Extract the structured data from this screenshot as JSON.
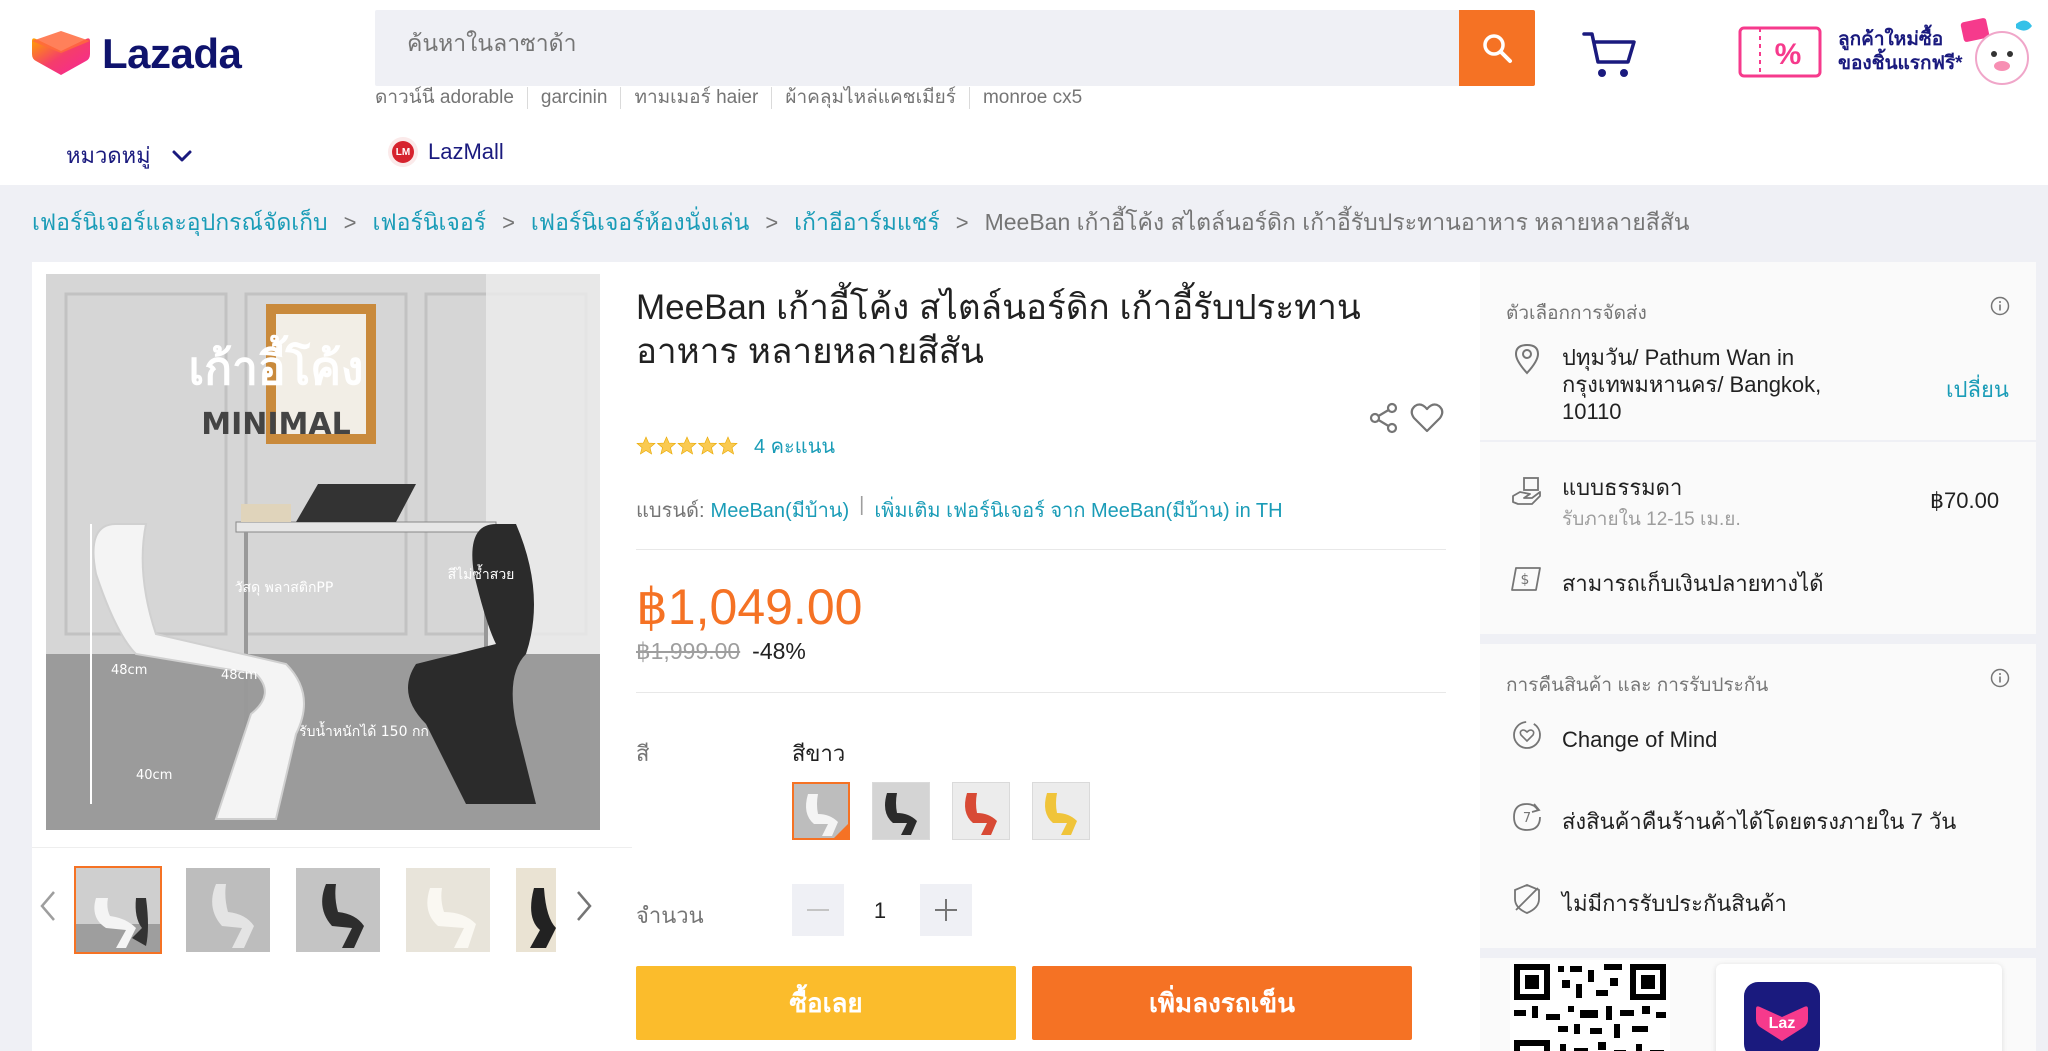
{
  "header": {
    "logo_text": "Lazada",
    "search_placeholder": "ค้นหาในลาซาด้า",
    "hot_words": [
      "ดาวน์นี adorable",
      "garcinin",
      "ทามเมอร์ haier",
      "ผ้าคลุมไหล่แคชเมียร์",
      "monroe cx5"
    ],
    "promo_text": "ลูกค้าใหม่ซื้อ ของชิ้นแรกฟรี*",
    "category_label": "หมวดหมู่",
    "lazmall_label": "LazMall"
  },
  "breadcrumb": {
    "items": [
      "เฟอร์นิเจอร์และอุปกรณ์จัดเก็บ",
      "เฟอร์นิเจอร์",
      "เฟอร์นิเจอร์ห้องนั่งเล่น",
      "เก้าอีอาร์มแชร์"
    ],
    "current": "MeeBan เก้าอี้โค้ง สไตล์นอร์ดิก เก้าอี้รับประทานอาหาร หลายหลายสีสัน"
  },
  "product": {
    "title": "MeeBan เก้าอี้โค้ง สไตล์นอร์ดิก เก้าอี้รับประทานอาหาร หลายหลายสีสัน",
    "rating_stars": 5,
    "rating_count": "4 คะแนน",
    "brand_label": "แบรนด์:",
    "brand_name": "MeeBan(มีบ้าน)",
    "brand_more": "เพิ่มเติม เฟอร์นิเจอร์ จาก MeeBan(มีบ้าน) in TH",
    "price": "฿1,049.00",
    "price_original": "฿1,999.00",
    "discount": "-48%",
    "color_label": "สี",
    "color_selected": "สีขาว",
    "swatch_colors": [
      "#e6e6e6",
      "#2b2b2b",
      "#d84a35",
      "#f0c43a"
    ],
    "quantity_label": "จำนวน",
    "quantity": "1",
    "buy_now_label": "ซื้อเลย",
    "add_to_cart_label": "เพิ่มลงรถเข็น",
    "image_text_main": "เก้าอี้โค้ง",
    "image_text_sub": "MINIMAL",
    "image_label_material": "วัสดุ พลาสติกPP",
    "image_label_colors": "สีไม่ซ้ำสวย",
    "image_label_load": "รับน้ำหนักได้ 150 กก",
    "image_dim_height": "48cm",
    "image_dim_seat": "48cm",
    "image_dim_base": "40cm"
  },
  "delivery": {
    "title": "ตัวเลือกการจัดส่ง",
    "location": "ปทุมวัน/ Pathum Wan in กรุงเทพมหานคร/ Bangkok, 10110",
    "change_label": "เปลี่ยน",
    "standard_label": "แบบธรรมดา",
    "standard_eta": "รับภายใน 12-15 เม.ย.",
    "standard_price": "฿70.00",
    "cod_label": "สามารถเก็บเงินปลายทางได้"
  },
  "returns": {
    "title": "การคืนสินค้า และ การรับประกัน",
    "change_of_mind": "Change of Mind",
    "return_7_days": "ส่งสินค้าคืนร้านค้าได้โดยตรงภายใน 7 วัน",
    "no_warranty": "ไม่มีการรับประกันสินค้า"
  },
  "app": {
    "icon_text": "Laz"
  },
  "colors": {
    "accent": "#f57224",
    "link": "#1a9cb7",
    "brand_navy": "#0f136d",
    "buy_yellow": "#fbbc2c"
  }
}
